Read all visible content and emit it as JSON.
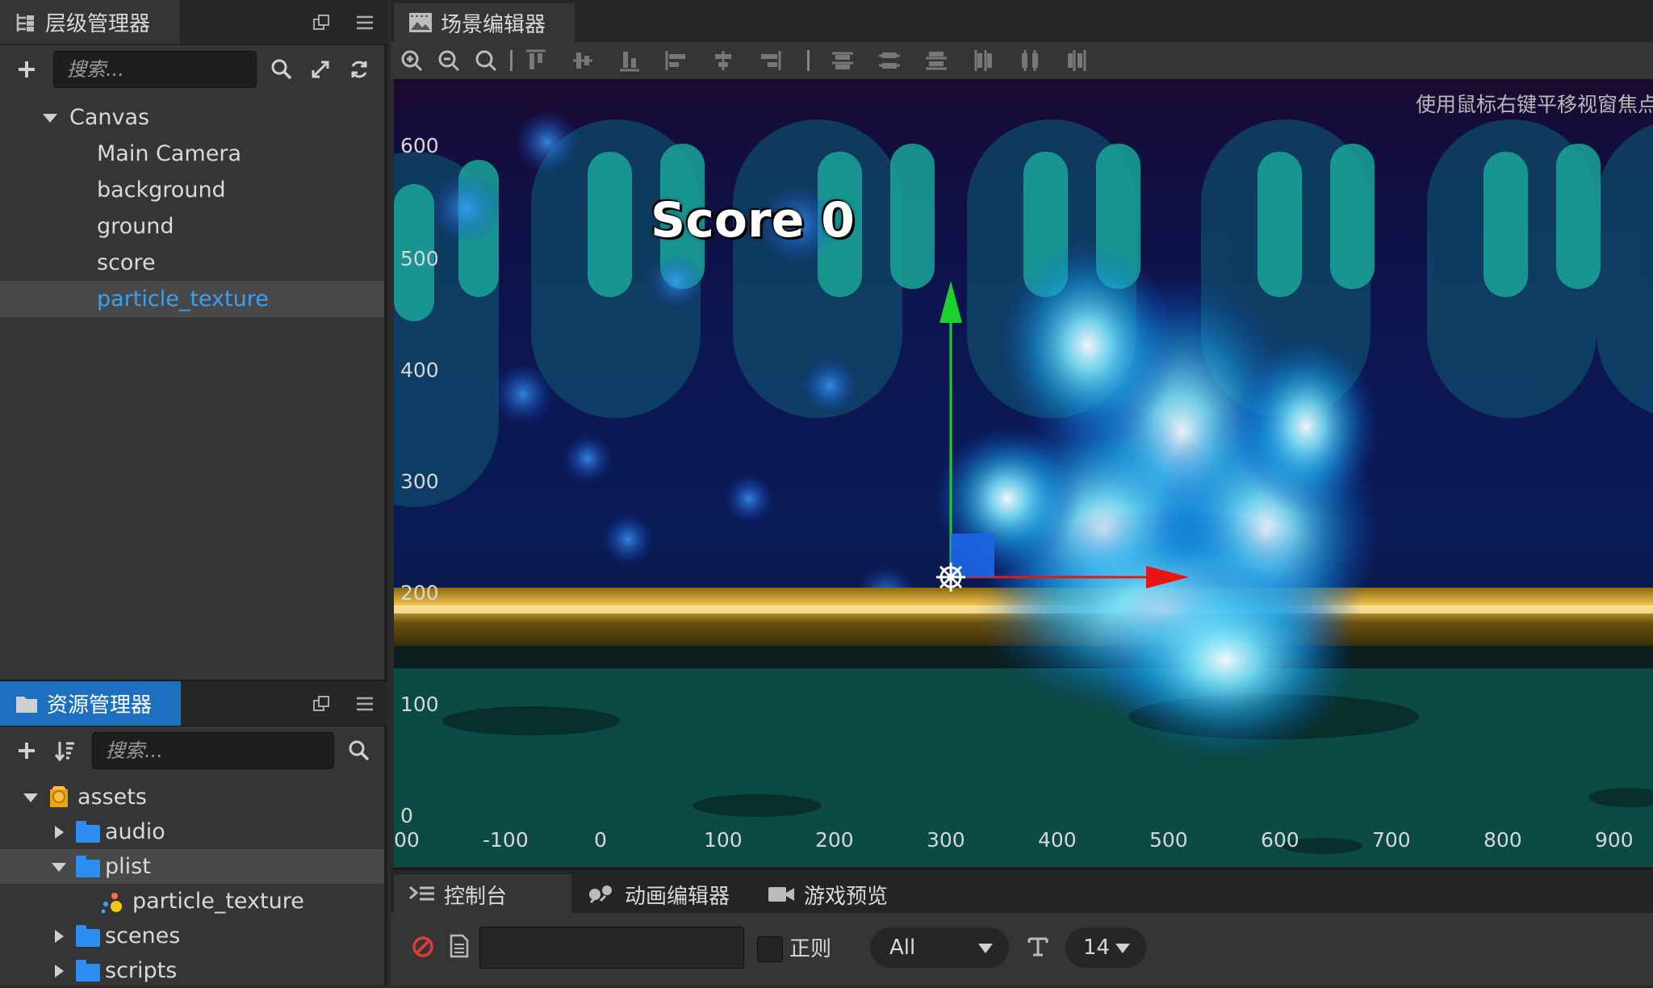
{
  "hierarchy": {
    "title": "层级管理器",
    "search_placeholder": "搜索...",
    "items": [
      {
        "label": "Canvas"
      },
      {
        "label": "Main Camera"
      },
      {
        "label": "background"
      },
      {
        "label": "ground"
      },
      {
        "label": "score"
      },
      {
        "label": "particle_texture"
      }
    ],
    "selected": "particle_texture"
  },
  "assets": {
    "title": "资源管理器",
    "search_placeholder": "搜索...",
    "items": [
      {
        "label": "assets"
      },
      {
        "label": "audio"
      },
      {
        "label": "plist"
      },
      {
        "label": "particle_texture"
      },
      {
        "label": "scenes"
      },
      {
        "label": "scripts"
      }
    ]
  },
  "scene": {
    "title": "场景编辑器",
    "hint": "使用鼠标右键平移视窗焦点",
    "score_text": "Score 0",
    "y_axis": [
      "600",
      "500",
      "400",
      "300",
      "200",
      "100",
      "0"
    ],
    "x_axis": [
      "00",
      "-100",
      "0",
      "100",
      "200",
      "300",
      "400",
      "500",
      "600",
      "700",
      "800",
      "900"
    ]
  },
  "console": {
    "tabs": [
      {
        "label": "控制台"
      },
      {
        "label": "动画编辑器"
      },
      {
        "label": "游戏预览"
      }
    ],
    "regex_label": "正则",
    "level_select": "All",
    "font_size": "14"
  },
  "colors": {
    "accent": "#1f6fc0",
    "selected_text": "#3aa1f2",
    "panel_bg": "#353535",
    "gizmo_x": "#e81515",
    "gizmo_y": "#1bd12b"
  }
}
